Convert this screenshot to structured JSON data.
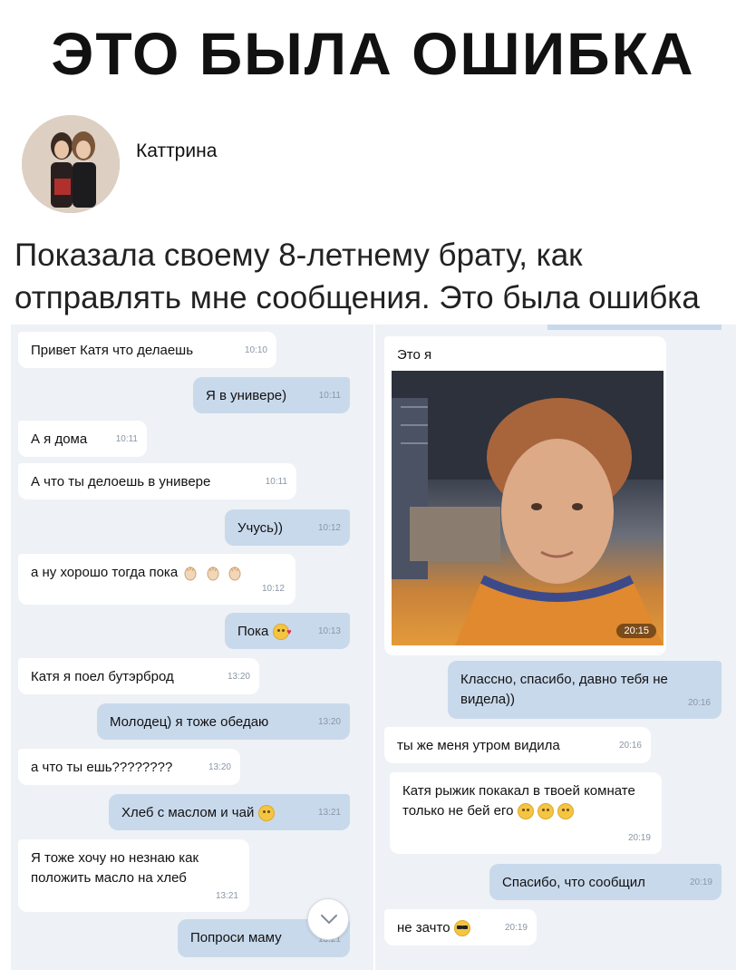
{
  "header": {
    "headline": "ЭТО БЫЛА ОШИБКА",
    "username": "Каттрина",
    "caption": "Показала своему 8-летнему брату, как отправлять мне сообщения. Это была ошибка"
  },
  "left_chat": [
    {
      "dir": "in",
      "text": "Привет Катя что делаешь",
      "time": "10:10"
    },
    {
      "dir": "out",
      "text": "Я в универе)",
      "time": "10:11"
    },
    {
      "dir": "in",
      "text": "А я дома",
      "time": "10:11"
    },
    {
      "dir": "in",
      "text": "А что ты делоешь в универе",
      "time": "10:11"
    },
    {
      "dir": "out",
      "text": "Учусь))",
      "time": "10:12"
    },
    {
      "dir": "in",
      "text": "а ну хорошо тогда пока",
      "time": "10:12",
      "emoji": [
        "clap-icon",
        "clap-icon",
        "clap-icon"
      ]
    },
    {
      "dir": "out",
      "text": "Пока",
      "time": "10:13",
      "emoji": [
        "kiss-emoji-icon"
      ]
    },
    {
      "dir": "in",
      "text": "Катя я поел бутэрброд",
      "time": "13:20"
    },
    {
      "dir": "out",
      "text": "Молодец) я тоже обедаю",
      "time": "13:20"
    },
    {
      "dir": "in",
      "text": "а что ты ешь????????",
      "time": "13:20"
    },
    {
      "dir": "out",
      "text": "Хлеб с маслом и чай",
      "time": "13:21",
      "emoji": [
        "grin-emoji-icon"
      ]
    },
    {
      "dir": "in",
      "text": "Я тоже хочу но незнаю как положить масло на хлеб",
      "time": "13:21"
    },
    {
      "dir": "out",
      "text": "Попроси маму",
      "time": "13:21"
    }
  ],
  "right_chat": [
    {
      "dir": "in",
      "text": "Это я"
    },
    {
      "dir": "in",
      "type": "photo",
      "time": "20:15"
    },
    {
      "dir": "out",
      "text": "Классно, спасибо, давно тебя не видела))",
      "time": "20:16"
    },
    {
      "dir": "in",
      "text": "ты же меня утром видила",
      "time": "20:16"
    },
    {
      "dir": "in",
      "text": "Катя рыжик покакал в твоей комнате только не бей его",
      "time": "20:19",
      "emoji": [
        "worried-emoji-icon",
        "worried-emoji-icon",
        "worried-emoji-icon"
      ]
    },
    {
      "dir": "out",
      "text": "Спасибо, что сообщил",
      "time": "20:19"
    },
    {
      "dir": "in",
      "text": "не зачто",
      "time": "20:19",
      "emoji": [
        "sunglasses-emoji-icon"
      ]
    }
  ],
  "colors": {
    "panel_bg": "#eef1f5",
    "incoming_bubble": "#ffffff",
    "outgoing_bubble": "#c9d9ec",
    "timestamp": "#8a96a6"
  },
  "icons": {
    "scroll_down": "chevron-down-icon"
  }
}
